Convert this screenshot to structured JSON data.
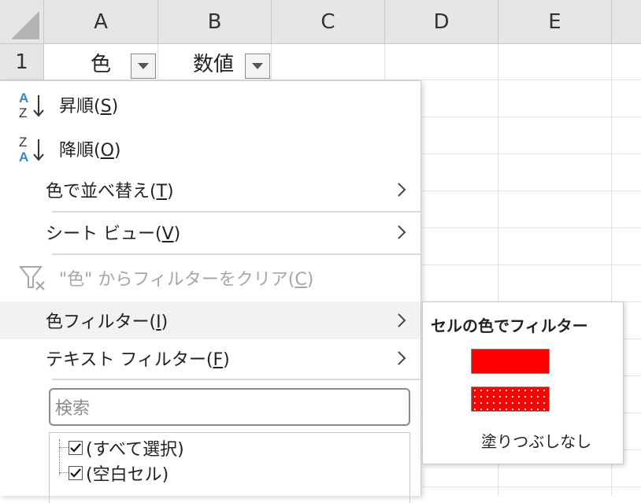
{
  "grid": {
    "columns": [
      "A",
      "B",
      "C",
      "D",
      "E"
    ],
    "rows": [
      "1"
    ],
    "header_cells": [
      {
        "column": "A",
        "value": "色"
      },
      {
        "column": "B",
        "value": "数値"
      }
    ]
  },
  "menu": {
    "sort_asc": {
      "label": "昇順(",
      "key": "S",
      "suffix": ")"
    },
    "sort_desc": {
      "label": "降順(",
      "key": "O",
      "suffix": ")"
    },
    "sort_by_color": {
      "label": "色で並べ替え(",
      "key": "T",
      "suffix": ")"
    },
    "sheet_view": {
      "label": "シート ビュー(",
      "key": "V",
      "suffix": ")"
    },
    "clear_filter": {
      "label": "\"色\" からフィルターをクリア(",
      "key": "C",
      "suffix": ")"
    },
    "color_filter": {
      "label": "色フィルター(",
      "key": "I",
      "suffix": ")"
    },
    "text_filter": {
      "label": "テキスト フィルター(",
      "key": "F",
      "suffix": ")"
    },
    "search_placeholder": "検索",
    "list_items": [
      {
        "label": "(すべて選択)",
        "checked": true
      },
      {
        "label": "(空白セル)",
        "checked": true
      }
    ]
  },
  "submenu": {
    "title": "セルの色でフィルター",
    "swatches": [
      {
        "name": "solid-red",
        "color": "#ff0000"
      },
      {
        "name": "dotted-red",
        "color": "#ff0000"
      }
    ],
    "no_fill_label": "塗りつぶしなし"
  },
  "colors": {
    "header_bg": "#e6e6e6",
    "hover_bg": "#f2f2f2",
    "sort_icon_blue": "#2b88d8",
    "swatch_red": "#ff0000",
    "disabled_text": "#a6a6a6"
  }
}
